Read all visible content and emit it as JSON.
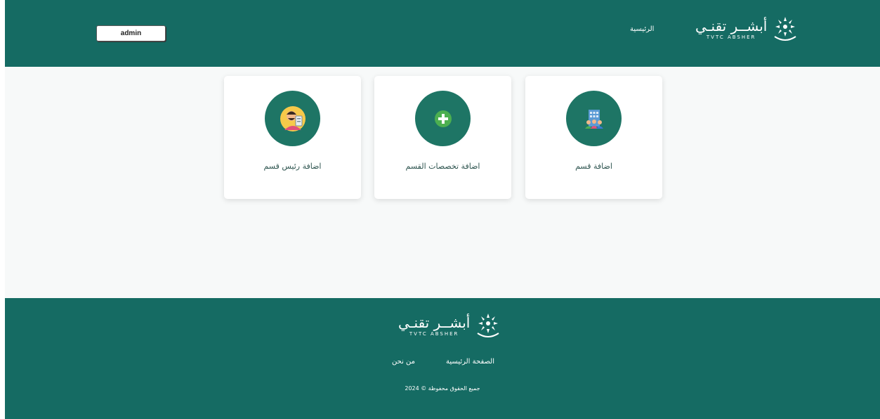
{
  "header": {
    "user_button": "admin",
    "nav_home": "الرئيسية",
    "logo_ar": "أبشــر تقنـي",
    "logo_en": "TVTC ABSHER"
  },
  "cards": [
    {
      "label": "اضافة قسم",
      "icon": "building-icon"
    },
    {
      "label": "اضافة تخصصات القسم",
      "icon": "plus-icon"
    },
    {
      "label": "اضافة رئيس قسم",
      "icon": "department-head-icon"
    }
  ],
  "footer": {
    "logo_ar": "أبشــر تقنـي",
    "logo_en": "TVTC ABSHER",
    "link_home": "الصفحة الرئيسية",
    "link_about": "من نحن",
    "copyright": "جميع الحقوق محفوظة © 2024"
  },
  "colors": {
    "primary": "#156b63",
    "icon_circle": "#1e7565",
    "plus": "#4caf50",
    "background": "#f7f9f9"
  }
}
